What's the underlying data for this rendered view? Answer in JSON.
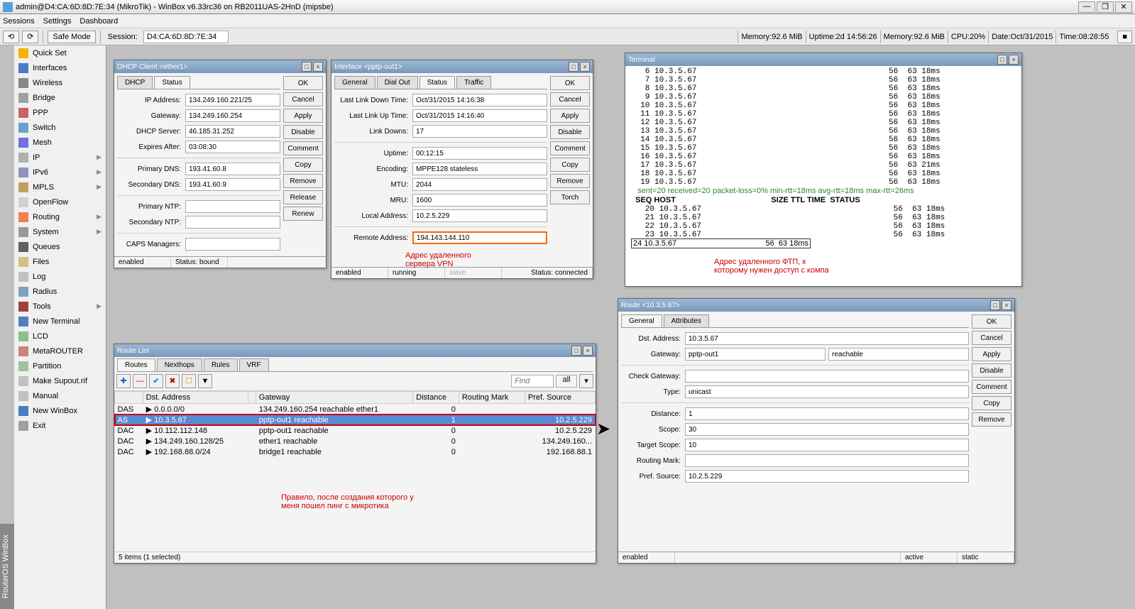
{
  "titlebar": "admin@D4:CA:6D:8D:7E:34 (MikroTik) - WinBox v6.33rc36 on RB2011UAS-2HnD (mipsbe)",
  "menu": [
    "Sessions",
    "Settings",
    "Dashboard"
  ],
  "toolbar": {
    "safe_mode": "Safe Mode",
    "session_label": "Session:",
    "session_val": "D4:CA:6D:8D:7E:34"
  },
  "status": [
    {
      "l": "Memory:",
      "v": "92.6 MiB"
    },
    {
      "l": "Uptime:",
      "v": "2d 14:56:26"
    },
    {
      "l": "Memory:",
      "v": "92.6 MiB"
    },
    {
      "l": "CPU:",
      "v": "20%"
    },
    {
      "l": "Date:",
      "v": "Oct/31/2015"
    },
    {
      "l": "Time:",
      "v": "08:28:55"
    }
  ],
  "sidebar": [
    {
      "t": "Quick Set",
      "i": "quick"
    },
    {
      "t": "Interfaces",
      "i": "if"
    },
    {
      "t": "Wireless",
      "i": "wifi"
    },
    {
      "t": "Bridge",
      "i": "bridge"
    },
    {
      "t": "PPP",
      "i": "ppp"
    },
    {
      "t": "Switch",
      "i": "switch"
    },
    {
      "t": "Mesh",
      "i": "mesh"
    },
    {
      "t": "IP",
      "i": "ip",
      "sub": true
    },
    {
      "t": "IPv6",
      "i": "ipv6",
      "sub": true
    },
    {
      "t": "MPLS",
      "i": "mpls",
      "sub": true
    },
    {
      "t": "OpenFlow",
      "i": "of"
    },
    {
      "t": "Routing",
      "i": "route",
      "sub": true
    },
    {
      "t": "System",
      "i": "sys",
      "sub": true
    },
    {
      "t": "Queues",
      "i": "queue"
    },
    {
      "t": "Files",
      "i": "files"
    },
    {
      "t": "Log",
      "i": "log"
    },
    {
      "t": "Radius",
      "i": "radius"
    },
    {
      "t": "Tools",
      "i": "tools",
      "sub": true
    },
    {
      "t": "New Terminal",
      "i": "term"
    },
    {
      "t": "LCD",
      "i": "lcd"
    },
    {
      "t": "MetaROUTER",
      "i": "mr"
    },
    {
      "t": "Partition",
      "i": "part"
    },
    {
      "t": "Make Supout.rif",
      "i": "supout"
    },
    {
      "t": "Manual",
      "i": "man"
    },
    {
      "t": "New WinBox",
      "i": "nwb"
    },
    {
      "t": "Exit",
      "i": "exit"
    }
  ],
  "vert": "RouterOS WinBox",
  "dhcp": {
    "title": "DHCP Client <ether1>",
    "tabs": [
      "DHCP",
      "Status"
    ],
    "fields": [
      {
        "l": "IP Address:",
        "v": "134.249.160.221/25"
      },
      {
        "l": "Gateway:",
        "v": "134.249.160.254"
      },
      {
        "l": "DHCP Server:",
        "v": "46.185.31.252"
      },
      {
        "l": "Expires After:",
        "v": "03:08:30"
      },
      {
        "l": "Primary DNS:",
        "v": "193.41.60.8"
      },
      {
        "l": "Secondary DNS:",
        "v": "193.41.60.9"
      },
      {
        "l": "Primary NTP:",
        "v": ""
      },
      {
        "l": "Secondary NTP:",
        "v": ""
      },
      {
        "l": "CAPS Managers:",
        "v": ""
      }
    ],
    "btns": [
      "OK",
      "Cancel",
      "Apply",
      "Disable",
      "Comment",
      "Copy",
      "Remove",
      "Release",
      "Renew"
    ],
    "st1": "enabled",
    "st2": "Status: bound"
  },
  "iface": {
    "title": "Interface <pptp-out1>",
    "tabs": [
      "General",
      "Dial Out",
      "Status",
      "Traffic"
    ],
    "fields": [
      {
        "l": "Last Link Down Time:",
        "v": "Oct/31/2015 14:16:38"
      },
      {
        "l": "Last Link Up Time:",
        "v": "Oct/31/2015 14:16:40"
      },
      {
        "l": "Link Downs:",
        "v": "17"
      },
      {
        "l": "Uptime:",
        "v": "00:12:15"
      },
      {
        "l": "Encoding:",
        "v": "MPPE128 stateless"
      },
      {
        "l": "MTU:",
        "v": "2044"
      },
      {
        "l": "MRU:",
        "v": "1600"
      },
      {
        "l": "Local Address:",
        "v": "10.2.5.229"
      },
      {
        "l": "Remote Address:",
        "v": "194.143.144.110",
        "hl": true
      }
    ],
    "btns": [
      "OK",
      "Cancel",
      "Apply",
      "Disable",
      "Comment",
      "Copy",
      "Remove",
      "Torch"
    ],
    "note": "Адрес удаленного\nсервера VPN",
    "st1": "enabled",
    "st2": "running",
    "st3": "slave",
    "st4": "Status: connected"
  },
  "terminal": {
    "title": "Terminal",
    "lines": [
      " 6 10.3.5.67                                         56  63 18ms",
      " 7 10.3.5.67                                         56  63 18ms",
      " 8 10.3.5.67                                         56  63 18ms",
      " 9 10.3.5.67                                         56  63 18ms",
      "10 10.3.5.67                                         56  63 18ms",
      "11 10.3.5.67                                         56  63 18ms",
      "12 10.3.5.67                                         56  63 18ms",
      "13 10.3.5.67                                         56  63 18ms",
      "14 10.3.5.67                                         56  63 18ms",
      "15 10.3.5.67                                         56  63 18ms",
      "16 10.3.5.67                                         56  63 18ms",
      "17 10.3.5.67                                         56  63 21ms",
      "18 10.3.5.67                                         56  63 18ms",
      "19 10.3.5.67                                         56  63 18ms"
    ],
    "stats": "   sent=20 received=20 packet-loss=0% min-rtt=18ms avg-rtt=18ms max-rtt=26ms",
    "hdr": "  SEQ HOST                                            SIZE TTL TIME  STATUS",
    "lines2": [
      "   20 10.3.5.67                                         56  63 18ms",
      "   21 10.3.5.67                                         56  63 18ms",
      "   22 10.3.5.67                                         56  63 18ms",
      "   23 10.3.5.67                                         56  63 18ms"
    ],
    "last": "   24 10.3.5.67                                         56  63 18ms",
    "note": "Адрес удаленного ФТП, к\nкоторому нужен доступ с компа"
  },
  "routelist": {
    "title": "Route List",
    "tabs": [
      "Routes",
      "Nexthops",
      "Rules",
      "VRF"
    ],
    "find": "Find",
    "all": "all",
    "cols": [
      "",
      "Dst. Address",
      "",
      "Gateway",
      "Distance",
      "Routing Mark",
      "Pref. Source"
    ],
    "rows": [
      {
        "f": "DAS",
        "d": "0.0.0.0/0",
        "g": "134.249.160.254 reachable ether1",
        "di": "0",
        "rm": "",
        "ps": ""
      },
      {
        "f": "AS",
        "d": "10.3.5.67",
        "g": "pptp-out1 reachable",
        "di": "1",
        "rm": "",
        "ps": "10.2.5.229",
        "sel": true
      },
      {
        "f": "DAC",
        "d": "10.112.112.148",
        "g": "pptp-out1 reachable",
        "di": "0",
        "rm": "",
        "ps": "10.2.5.229"
      },
      {
        "f": "DAC",
        "d": "134.249.160.128/25",
        "g": "ether1 reachable",
        "di": "0",
        "rm": "",
        "ps": "134.249.160..."
      },
      {
        "f": "DAC",
        "d": "192.168.88.0/24",
        "g": "bridge1 reachable",
        "di": "0",
        "rm": "",
        "ps": "192.168.88.1"
      }
    ],
    "note": "Правило, после создания которого у\nменя пошел пинг с микротика",
    "status": "5 items (1 selected)"
  },
  "route": {
    "title": "Route <10.3.5.67>",
    "tabs": [
      "General",
      "Attributes"
    ],
    "fields": [
      {
        "l": "Dst. Address:",
        "v": "10.3.5.67"
      },
      {
        "l": "Gateway:",
        "v": "pptp-out1",
        "extra": "reachable"
      },
      {
        "l": "Check Gateway:",
        "v": ""
      },
      {
        "l": "Type:",
        "v": "unicast"
      },
      {
        "l": "Distance:",
        "v": "1"
      },
      {
        "l": "Scope:",
        "v": "30"
      },
      {
        "l": "Target Scope:",
        "v": "10"
      },
      {
        "l": "Routing Mark:",
        "v": ""
      },
      {
        "l": "Pref. Source:",
        "v": "10.2.5.229"
      }
    ],
    "btns": [
      "OK",
      "Cancel",
      "Apply",
      "Disable",
      "Comment",
      "Copy",
      "Remove"
    ],
    "st1": "enabled",
    "st2": "active",
    "st3": "static"
  }
}
